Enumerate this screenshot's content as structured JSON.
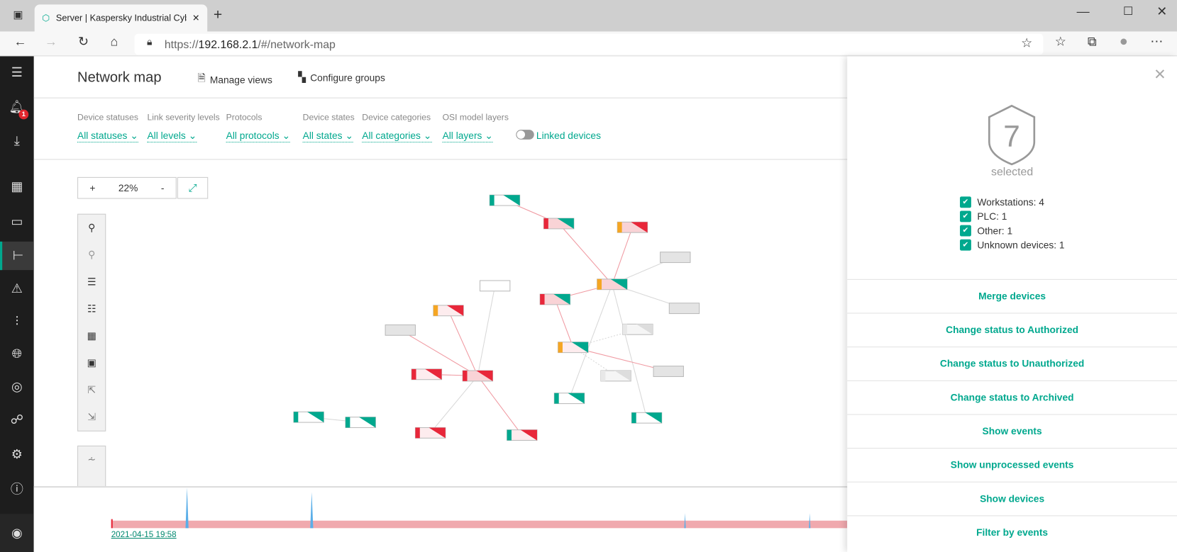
{
  "browser": {
    "tab_title": "Server | Kaspersky Industrial Cyb",
    "url_prefix": "https://",
    "url_host": "192.168.2.1",
    "url_path": "/#/network-map"
  },
  "sidebar": {
    "notification_count": "1",
    "items": [
      "menu",
      "notifications",
      "download",
      "dashboard",
      "assets",
      "network-map",
      "alerts",
      "settings-sliders",
      "internet",
      "risks",
      "topology",
      "settings",
      "about",
      "user"
    ]
  },
  "header": {
    "title": "Network map",
    "manage_views": "Manage views",
    "configure_groups": "Configure groups"
  },
  "filters": [
    {
      "label": "Device statuses",
      "value": "All statuses"
    },
    {
      "label": "Link severity levels",
      "value": "All levels"
    },
    {
      "label": "Protocols",
      "value": "All protocols"
    },
    {
      "label": "Device states",
      "value": "All states"
    },
    {
      "label": "Device categories",
      "value": "All categories"
    },
    {
      "label": "OSI model layers",
      "value": "All layers"
    }
  ],
  "linked_devices": {
    "label": "Linked devices",
    "enabled": false
  },
  "zoom": {
    "plus": "+",
    "level": "22%",
    "minus": "-"
  },
  "colors": {
    "accent": "#00a88e",
    "alert": "#e8273a",
    "warning": "#f5a623",
    "unknown": "#e4e4e4"
  },
  "map_nodes": [
    {
      "status": "#00a88e",
      "fill": "#ffffff",
      "tri": "#00a88e"
    },
    {
      "status": "#e8273a",
      "fill": "#f9d3d6",
      "tri": "#00a88e"
    },
    {
      "status": "#f5a623",
      "fill": "#f9d3d6",
      "tri": "#e8273a"
    },
    {
      "status": null,
      "fill": "#e4e4e4",
      "tri": null
    },
    {
      "status": "#f5a623",
      "fill": "#f9d3d6",
      "tri": "#00a88e"
    },
    {
      "status": null,
      "fill": "#ffffff",
      "tri": null
    },
    {
      "status": "#e8273a",
      "fill": "#f9d3d6",
      "tri": "#00a88e"
    },
    {
      "status": null,
      "fill": "#e4e4e4",
      "tri": null
    },
    {
      "status": "#f5a623",
      "fill": "#fdecee",
      "tri": "#e8273a"
    },
    {
      "status": null,
      "fill": "#e4e4e4",
      "tri": null
    },
    {
      "status": "#e8e8e8",
      "fill": "#f5f5f5",
      "tri": "#dddddd"
    },
    {
      "status": "#f5a623",
      "fill": "#fdecee",
      "tri": "#00a88e"
    },
    {
      "status": null,
      "fill": "#e4e4e4",
      "tri": null
    },
    {
      "status": "#e8273a",
      "fill": "#fdecee",
      "tri": "#e8273a"
    },
    {
      "status": "#e8273a",
      "fill": "#f9d3d6",
      "tri": "#e8273a"
    },
    {
      "status": "#e8e8e8",
      "fill": "#f5f5f5",
      "tri": "#dddddd"
    },
    {
      "status": "#00a88e",
      "fill": "#ffffff",
      "tri": "#00a88e"
    },
    {
      "status": "#00a88e",
      "fill": "#ffffff",
      "tri": "#00a88e"
    },
    {
      "status": "#00a88e",
      "fill": "#ffffff",
      "tri": "#00a88e"
    },
    {
      "status": "#00a88e",
      "fill": "#ffffff",
      "tri": "#00a88e"
    },
    {
      "status": "#e8273a",
      "fill": "#fdecee",
      "tri": "#e8273a"
    },
    {
      "status": "#00a88e",
      "fill": "#fdecee",
      "tri": "#e8273a"
    }
  ],
  "timeline": {
    "start": "2021-04-15 19:58"
  },
  "panel": {
    "count": "7",
    "selected_label": "selected",
    "categories": [
      {
        "label": "Workstations: 4",
        "checked": true
      },
      {
        "label": "PLC: 1",
        "checked": true
      },
      {
        "label": "Other: 1",
        "checked": true
      },
      {
        "label": "Unknown devices: 1",
        "checked": true
      }
    ],
    "actions": [
      "Merge devices",
      "Change status to Authorized",
      "Change status to Unauthorized",
      "Change status to Archived",
      "Show events",
      "Show unprocessed events",
      "Show devices",
      "Filter by events"
    ]
  }
}
